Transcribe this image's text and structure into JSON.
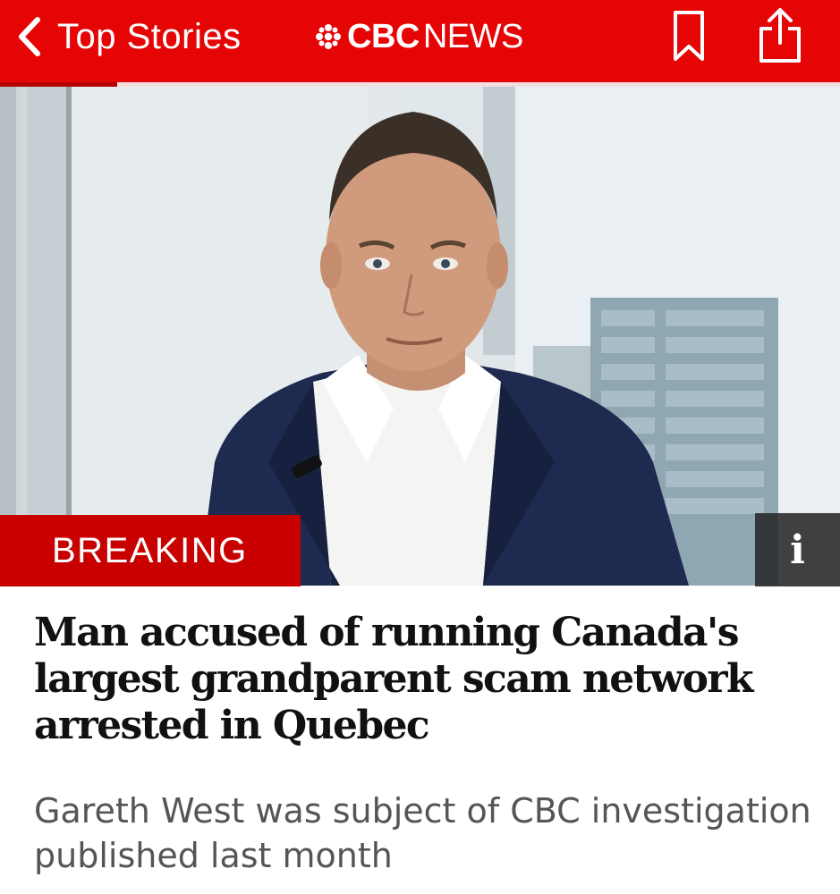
{
  "topbar": {
    "back_label": "Top Stories",
    "logo_bold": "CBC",
    "logo_light": "NEWS",
    "brand_color": "#e60505",
    "icons": [
      "chevron-left-icon",
      "cbc-gem-icon",
      "bookmark-icon",
      "share-icon"
    ]
  },
  "reading_progress": 0.14,
  "hero": {
    "badge": "BREAKING",
    "info_label": "i",
    "badge_color": "#c80000"
  },
  "article": {
    "headline": "Man accused of running Canada's largest grandparent scam network arrested in Quebec",
    "subheadline": "Gareth West was subject of CBC investigation published last month"
  }
}
